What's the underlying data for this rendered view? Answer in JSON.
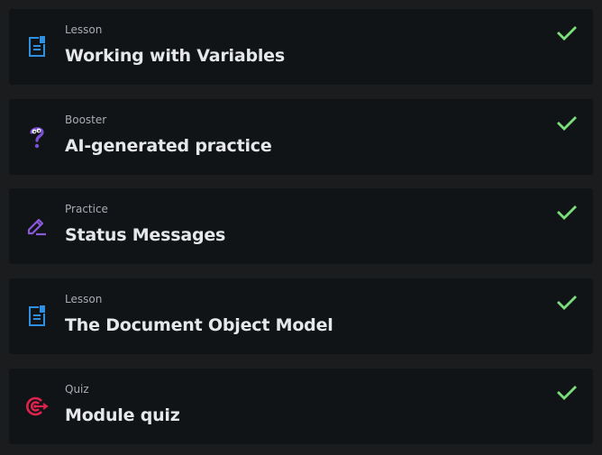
{
  "items": [
    {
      "kind": "Lesson",
      "title": "Working with Variables",
      "icon": "lesson-document-icon",
      "completed": true
    },
    {
      "kind": "Booster",
      "title": "AI-generated practice",
      "icon": "question-mark-icon",
      "completed": true
    },
    {
      "kind": "Practice",
      "title": "Status Messages",
      "icon": "pencil-icon",
      "completed": true
    },
    {
      "kind": "Lesson",
      "title": "The Document Object Model",
      "icon": "lesson-document-icon",
      "completed": true
    },
    {
      "kind": "Quiz",
      "title": "Module quiz",
      "icon": "target-icon",
      "completed": true
    }
  ],
  "colors": {
    "lesson_icon": "#2f8fe0",
    "booster_icon": "#7b4fd6",
    "practice_icon": "#8a5ad9",
    "quiz_icon": "#e0234e",
    "check": "#7be07b"
  }
}
